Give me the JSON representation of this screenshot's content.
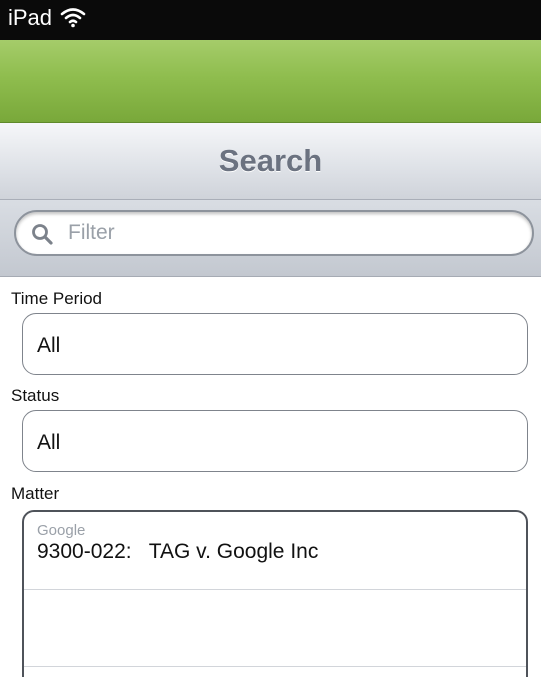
{
  "status_bar": {
    "carrier": "iPad",
    "wifi_icon": "wifi-icon"
  },
  "colors": {
    "accent_green": "#8fbd4e",
    "status_bar": "#0a0a0a",
    "header_text": "#6b7280"
  },
  "header": {
    "title": "Search"
  },
  "filter": {
    "placeholder": "Filter",
    "value": "",
    "icon": "search-icon"
  },
  "form": {
    "time_period": {
      "label": "Time Period",
      "value": "All"
    },
    "status": {
      "label": "Status",
      "value": "All"
    },
    "matter": {
      "label": "Matter",
      "section": "Google",
      "items": [
        {
          "label": "9300-022:   TAG v. Google Inc"
        },
        {
          "label": ""
        }
      ]
    }
  }
}
